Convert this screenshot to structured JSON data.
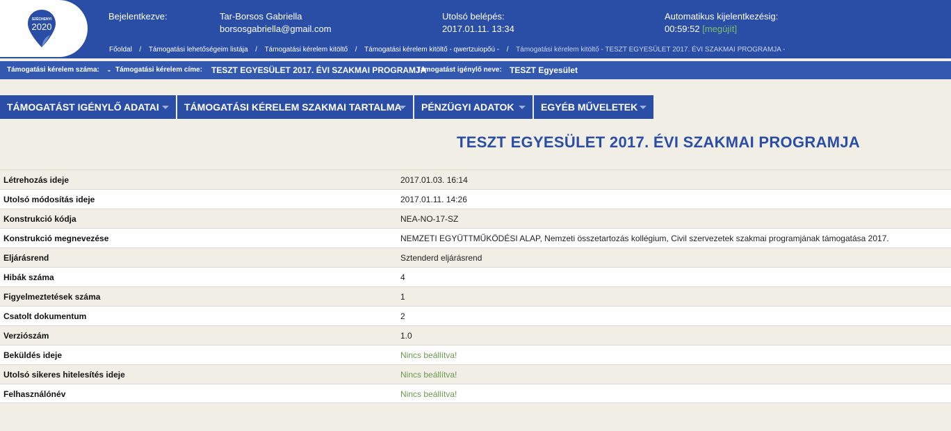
{
  "header": {
    "logo_text_top": "SZÉCHENYI",
    "logo_text_year": "2020",
    "logged_in_label": "Bejelentkezve:",
    "user_name": "Tar-Borsos Gabriella",
    "user_email": "borsosgabriella@gmail.com",
    "last_login_label": "Utolsó belépés:",
    "last_login_value": "2017.01.11. 13:34",
    "auto_logout_label": "Automatikus kijelentkezésig:",
    "auto_logout_time": "00:59:52",
    "renew_label": "[megújít]"
  },
  "breadcrumb": {
    "separator": "/",
    "items": [
      "Főoldal",
      "Támogatási lehetőségeim listája",
      "Támogatási kérelem kitöltő",
      "Támogatási kérelem kitöltő - qwertzuiopőú -",
      "Támogatási kérelem kitöltő - TESZT EGYESÜLET 2017. ÉVI SZAKMAI PROGRAMJA -"
    ]
  },
  "infobar": {
    "number_label": "Támogatási kérelem száma:",
    "number_value": "-",
    "title_label": "Támogatási kérelem címe:",
    "title_value": "TESZT EGYESÜLET 2017. ÉVI SZAKMAI PROGRAMJA",
    "applicant_label": "Támogatást igénylő neve:",
    "applicant_value": "TESZT Egyesület"
  },
  "menu": [
    {
      "label": "TÁMOGATÁST IGÉNYLŐ ADATAI"
    },
    {
      "label": "TÁMOGATÁSI KÉRELEM SZAKMAI TARTALMA"
    },
    {
      "label": "PÉNZÜGYI ADATOK"
    },
    {
      "label": "EGYÉB MŰVELETEK"
    }
  ],
  "page_title": "TESZT EGYESÜLET 2017. ÉVI SZAKMAI PROGRAMJA",
  "details": [
    {
      "key": "Létrehozás ideje",
      "value": "2017.01.03. 16:14"
    },
    {
      "key": "Utolsó módosítás ideje",
      "value": "2017.01.11. 14:26"
    },
    {
      "key": "Konstrukció kódja",
      "value": "NEA-NO-17-SZ"
    },
    {
      "key": "Konstrukció megnevezése",
      "value": "NEMZETI EGYÜTTMŰKÖDÉSI ALAP, Nemzeti összetartozás kollégium, Civil szervezetek szakmai programjának támogatása 2017."
    },
    {
      "key": "Eljárásrend",
      "value": "Sztenderd eljárásrend"
    },
    {
      "key": "Hibák száma",
      "value": "4"
    },
    {
      "key": "Figyelmeztetések száma",
      "value": "1"
    },
    {
      "key": "Csatolt dokumentum",
      "value": "2"
    },
    {
      "key": "Verziószám",
      "value": "1.0"
    },
    {
      "key": "Beküldés ideje",
      "value": "Nincs beállítva!"
    },
    {
      "key": "Utolsó sikeres hitelesítés ideje",
      "value": "Nincs beállítva!"
    },
    {
      "key": "Felhasználónév",
      "value": "Nincs beállítva!"
    }
  ],
  "colors": {
    "brand_blue": "#2a4ea6",
    "infobar_blue": "#3358b0",
    "page_bg": "#f1eee6",
    "not_set_green": "#6a9a4e"
  }
}
